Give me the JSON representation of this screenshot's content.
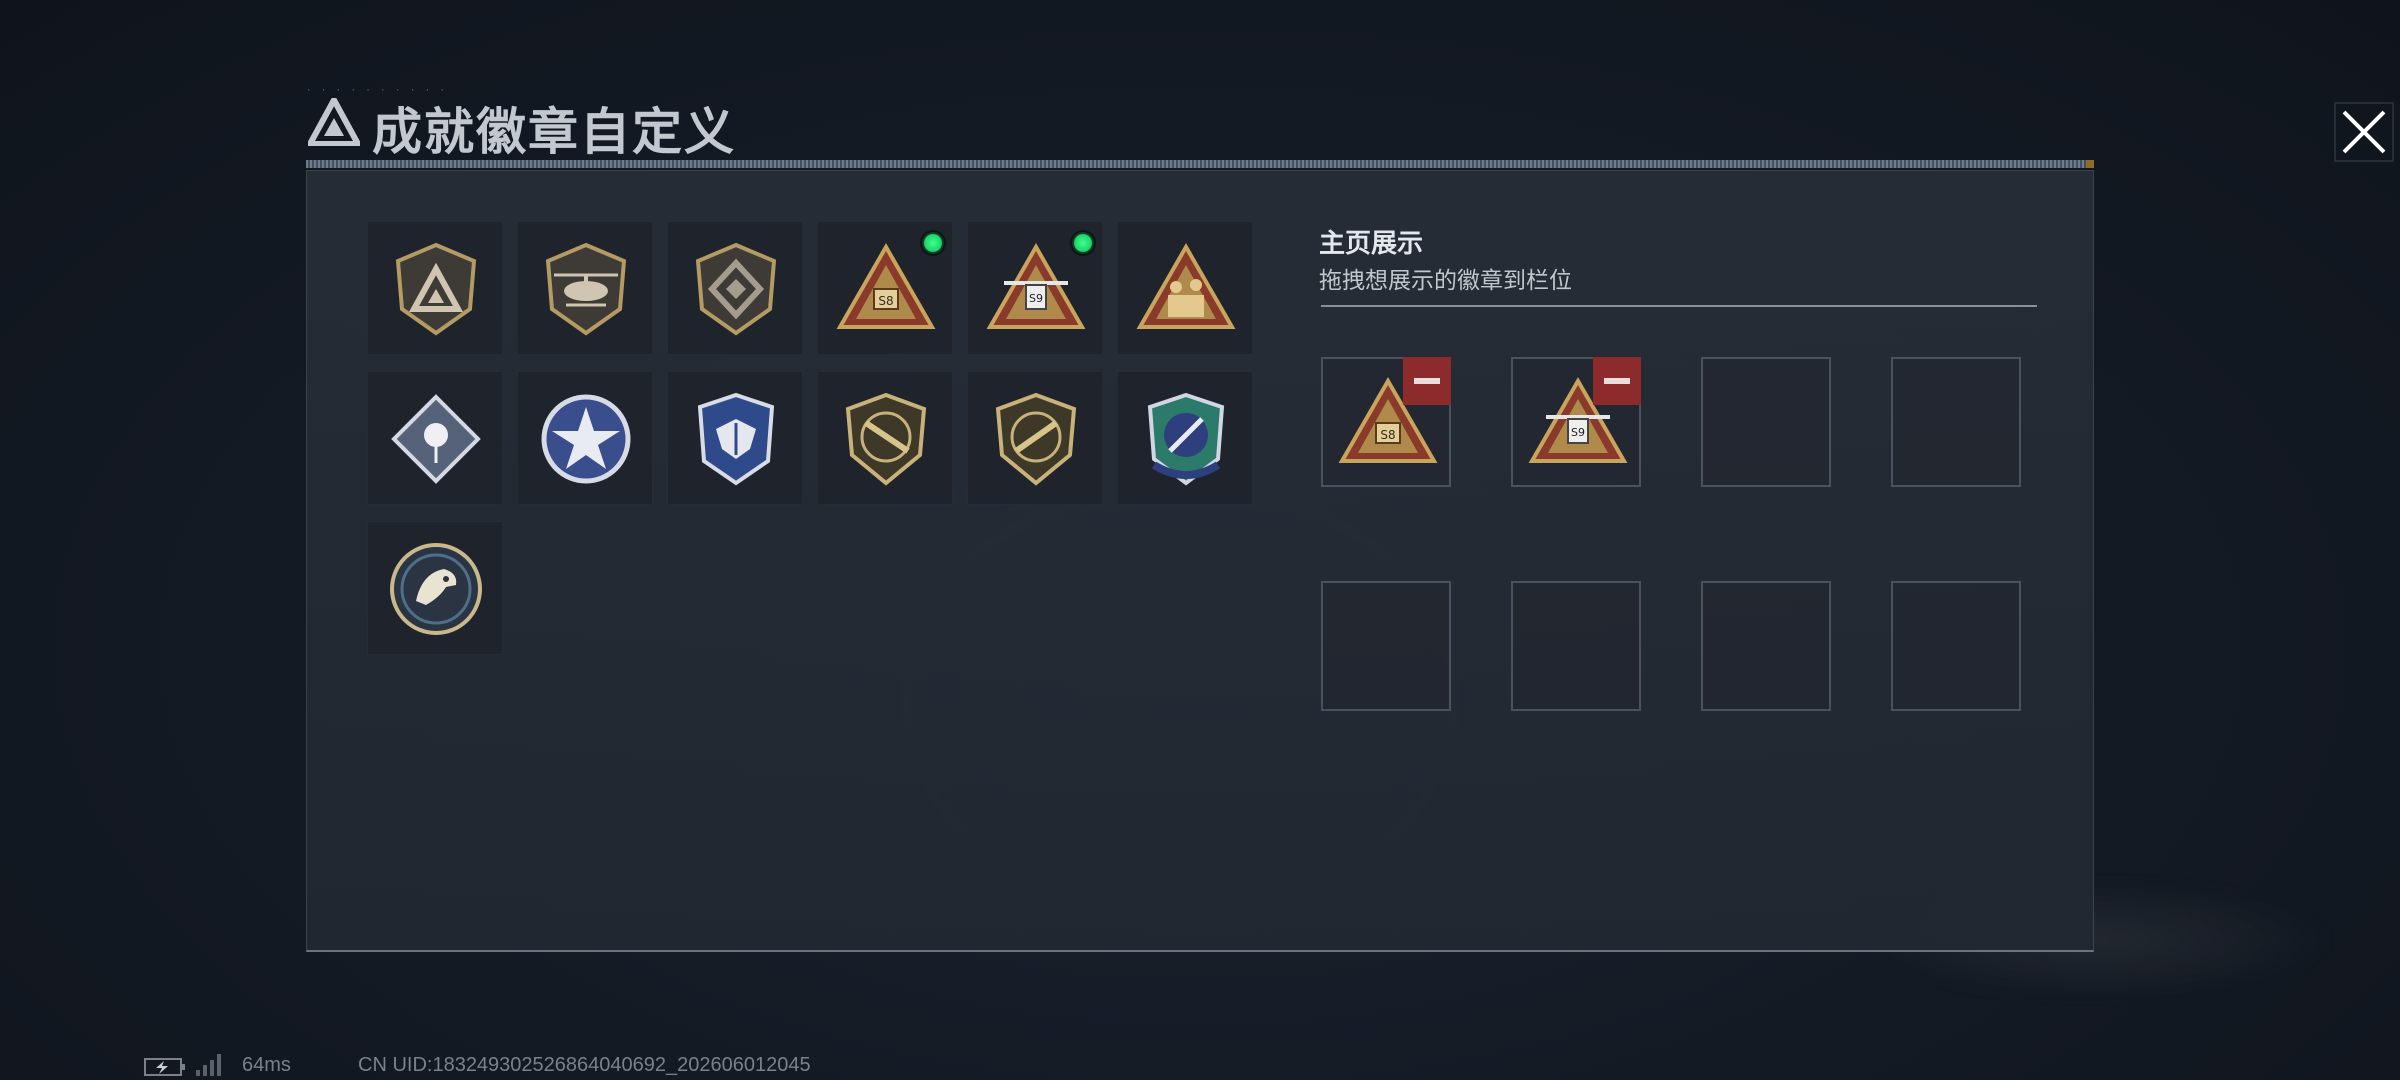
{
  "header": {
    "title": "成就徽章自定义",
    "close_icon": "close-icon",
    "logo_icon": "triangle-logo-icon"
  },
  "badge_list": {
    "badges": [
      {
        "icon": "triangle-shield-badge-icon",
        "active": false
      },
      {
        "icon": "helicopter-shield-badge-icon",
        "active": false
      },
      {
        "icon": "diamond-shield-badge-icon",
        "active": false
      },
      {
        "icon": "s8-triangle-badge-icon",
        "active": true
      },
      {
        "icon": "s9-triangle-badge-icon",
        "active": true
      },
      {
        "icon": "soldiers-triangle-badge-icon",
        "active": false
      },
      {
        "icon": "rose-diamond-badge-icon",
        "active": false
      },
      {
        "icon": "star-round-badge-icon",
        "active": false
      },
      {
        "icon": "winged-blue-shield-badge-icon",
        "active": false
      },
      {
        "icon": "rifle-gold-shield-badge-icon",
        "active": false
      },
      {
        "icon": "smg-gold-shield-badge-icon",
        "active": false
      },
      {
        "icon": "knife-blue-shield-badge-icon",
        "active": false
      },
      {
        "icon": "eagle-round-badge-icon",
        "active": false
      }
    ]
  },
  "display": {
    "title": "主页展示",
    "subtitle": "拖拽想展示的徽章到栏位",
    "slots": [
      {
        "badge": "s8-triangle-badge-icon",
        "removable": true
      },
      {
        "badge": "s9-triangle-badge-icon",
        "removable": true
      },
      {
        "badge": "",
        "removable": false
      },
      {
        "badge": "",
        "removable": false
      },
      {
        "badge": "",
        "removable": false
      },
      {
        "badge": "",
        "removable": false
      },
      {
        "badge": "",
        "removable": false
      },
      {
        "badge": "",
        "removable": false
      }
    ]
  },
  "footer": {
    "ping": "64ms",
    "uid": "CN UID:1832493025268640406​92_202606012045"
  },
  "colors": {
    "gold": "#c2a46a",
    "active_green": "#1fd46a",
    "remove_red": "#8d2a2c"
  }
}
